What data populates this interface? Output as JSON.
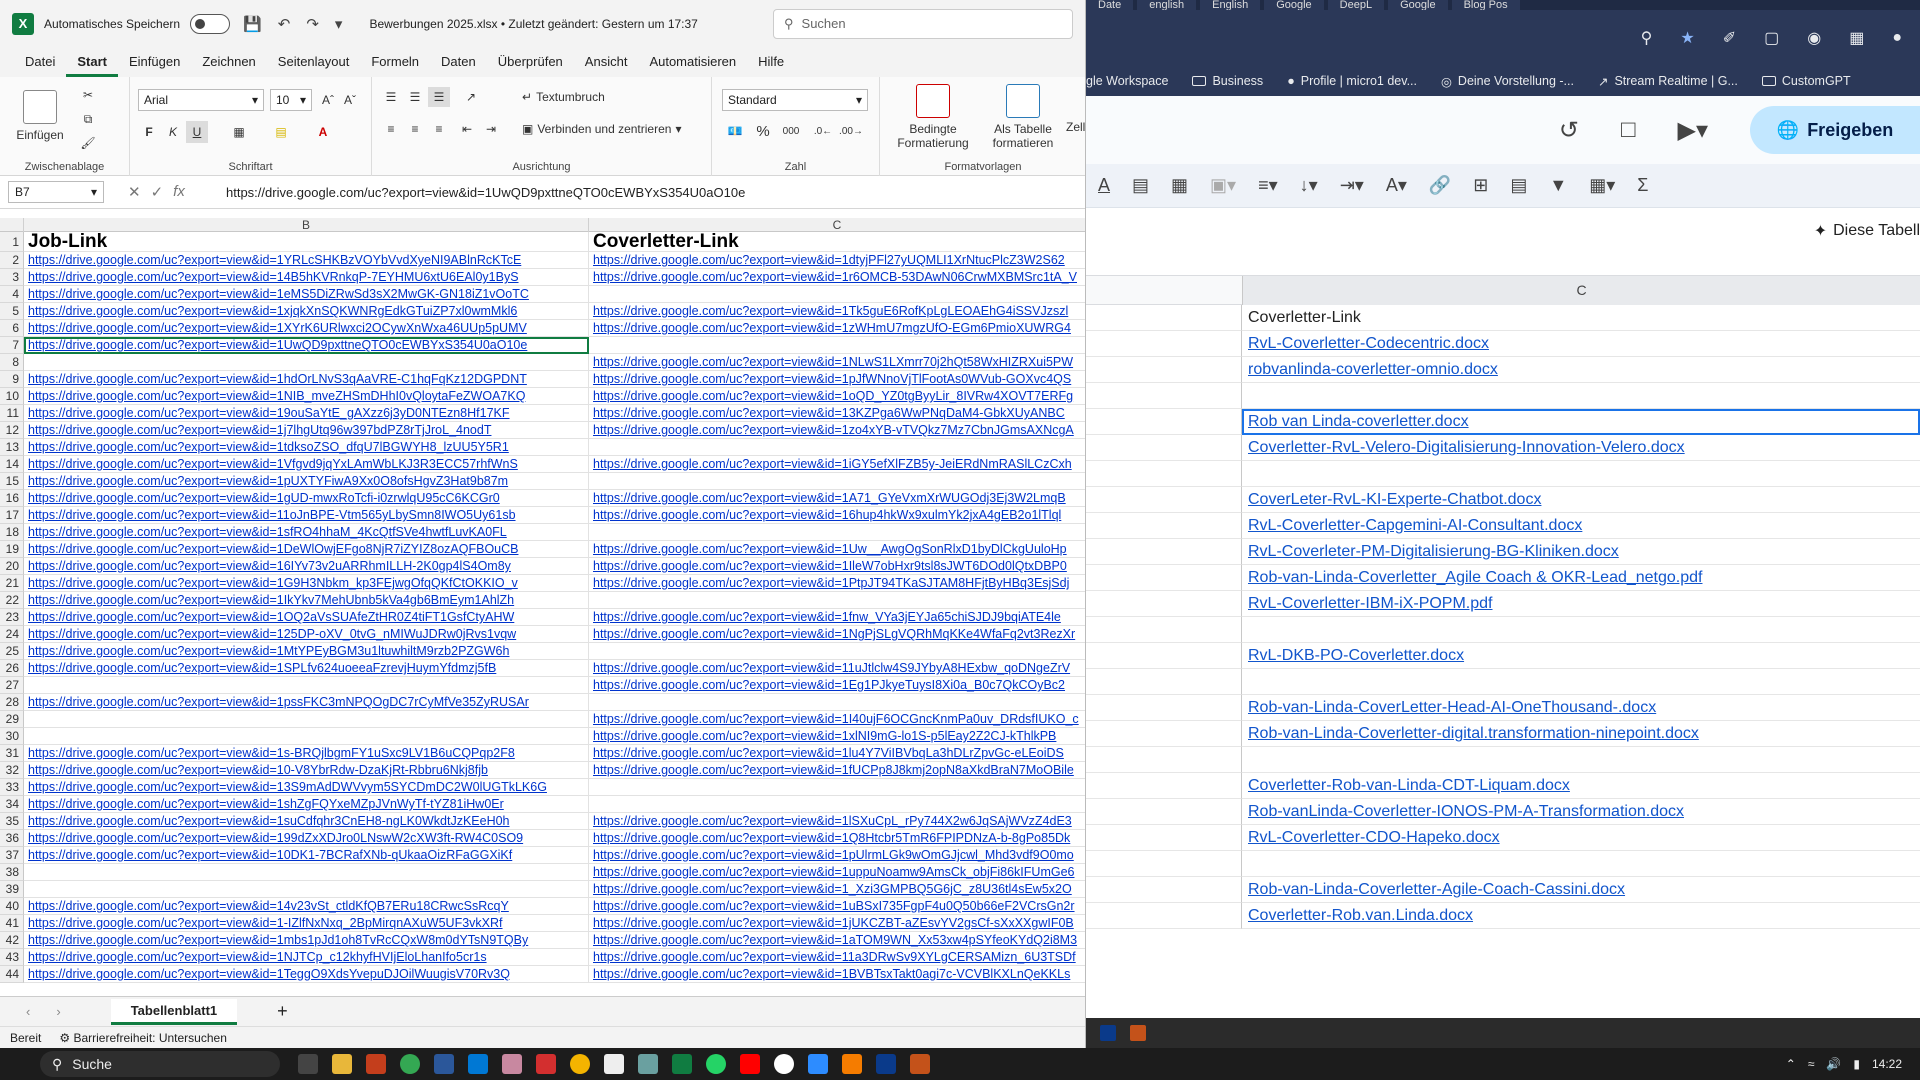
{
  "excel": {
    "title_bar": {
      "autosave_label": "Automatisches Speichern",
      "filename": "Bewerbungen 2025.xlsx • Zuletzt geändert: Gestern um 17:37",
      "search_placeholder": "Suchen"
    },
    "menu": [
      "Datei",
      "Start",
      "Einfügen",
      "Zeichnen",
      "Seitenlayout",
      "Formeln",
      "Daten",
      "Überprüfen",
      "Ansicht",
      "Automatisieren",
      "Hilfe"
    ],
    "ribbon": {
      "paste_label": "Einfügen",
      "clipboard_group": "Zwischenablage",
      "font_name": "Arial",
      "font_size": "10",
      "font_group": "Schriftart",
      "wrap_text": "Textumbruch",
      "merge_center": "Verbinden und zentrieren",
      "align_group": "Ausrichtung",
      "number_format": "Standard",
      "number_group": "Zahl",
      "cond_format": "Bedingte Formatierung",
      "table_format": "Als Tabelle formatieren",
      "cell_styles": "Zeller",
      "styles_group": "Formatvorlagen",
      "bold": "F",
      "italic": "K",
      "underline": "U"
    },
    "namebox": "B7",
    "formula": "https://drive.google.com/uc?export=view&id=1UwQD9pxttneQTO0cEWBYxS354U0aO10e",
    "columns": [
      "B",
      "C"
    ],
    "header_row": {
      "b": "Job-Link",
      "c": "Coverletter-Link"
    },
    "rows": [
      {
        "n": "2",
        "b": "https://drive.google.com/uc?export=view&id=1YRLcSHKBzVOYbVvdXyeNI9ABlnRcKTcE",
        "c": "https://drive.google.com/uc?export=view&id=1dtyjPFl27yUQMLI1XrNtucPlcZ3W2S62"
      },
      {
        "n": "3",
        "b": "https://drive.google.com/uc?export=view&id=14B5hKVRnkqP-7EYHMU6xtU6EAl0y1ByS",
        "c": "https://drive.google.com/uc?export=view&id=1r6OMCB-53DAwN06CrwMXBMSrc1tA_V"
      },
      {
        "n": "4",
        "b": "https://drive.google.com/uc?export=view&id=1eMS5DiZRwSd3sX2MwGK-GN18iZ1vOoTC",
        "c": ""
      },
      {
        "n": "5",
        "b": "https://drive.google.com/uc?export=view&id=1xjqkXnSQKWNRgEdkGTuiZP7xl0wmMkl6",
        "c": "https://drive.google.com/uc?export=view&id=1Tk5guE6RofKpLgLEOAEhG4iSSVJzszl"
      },
      {
        "n": "6",
        "b": "https://drive.google.com/uc?export=view&id=1XYrK6URlwxci2OCywXnWxa46UUp5pUMV",
        "c": "https://drive.google.com/uc?export=view&id=1zWHmU7mgzUfO-EGm6PmioXUWRG4"
      },
      {
        "n": "7",
        "b": "https://drive.google.com/uc?export=view&id=1UwQD9pxttneQTO0cEWBYxS354U0aO10e",
        "c": ""
      },
      {
        "n": "8",
        "b": "",
        "c": "https://drive.google.com/uc?export=view&id=1NLwS1LXmrr70j2hQt58WxHIZRXui5PW"
      },
      {
        "n": "9",
        "b": "https://drive.google.com/uc?export=view&id=1hdOrLNvS3qAaVRE-C1hqFqKz12DGPDNT",
        "c": "https://drive.google.com/uc?export=view&id=1pJfWNnoVjTlFootAs0WVub-GOXvc4QS"
      },
      {
        "n": "10",
        "b": "https://drive.google.com/uc?export=view&id=1NIB_mveZHSmDHhI0vQloytaFeZWOA7KQ",
        "c": "https://drive.google.com/uc?export=view&id=1oQD_YZ0tgByyLir_8IVRw4XOVT7ERFg"
      },
      {
        "n": "11",
        "b": "https://drive.google.com/uc?export=view&id=19ouSaYtE_gAXzz6j3yD0NTEzn8Hf17KF",
        "c": "https://drive.google.com/uc?export=view&id=13KZPga6WwPNqDaM4-GbkXUyANBC"
      },
      {
        "n": "12",
        "b": "https://drive.google.com/uc?export=view&id=1j7lhgUtq96w397bdPZ8rTjJroL_4nodT",
        "c": "https://drive.google.com/uc?export=view&id=1zo4xYB-vTVQkz7Mz7CbnJGmsAXNcgA"
      },
      {
        "n": "13",
        "b": "https://drive.google.com/uc?export=view&id=1tdksoZSO_dfqU7lBGWYH8_lzUU5Y5R1",
        "c": ""
      },
      {
        "n": "14",
        "b": "https://drive.google.com/uc?export=view&id=1Vfgvd9jqYxLAmWbLKJ3R3ECC57rhfWnS",
        "c": "https://drive.google.com/uc?export=view&id=1iGY5efXlFZB5y-JeiERdNmRASlLCzCxh"
      },
      {
        "n": "15",
        "b": "https://drive.google.com/uc?export=view&id=1pUXTYFiwA9Xx0O8ofsHgvZ3Hat9b87m",
        "c": ""
      },
      {
        "n": "16",
        "b": "https://drive.google.com/uc?export=view&id=1gUD-mwxRoTcfi-i0zrwlqU95cC6KCGr0",
        "c": "https://drive.google.com/uc?export=view&id=1A71_GYeVxmXrWUGOdj3Ej3W2LmqB"
      },
      {
        "n": "17",
        "b": "https://drive.google.com/uc?export=view&id=11oJnBPE-Vtm565yLbySmn8IWO5Uy61sb",
        "c": "https://drive.google.com/uc?export=view&id=16hup4hkWx9xulmYk2jxA4gEB2o1lTlql"
      },
      {
        "n": "18",
        "b": "https://drive.google.com/uc?export=view&id=1sfRO4hhaM_4KcQtfSVe4hwtfLuvKA0FL",
        "c": ""
      },
      {
        "n": "19",
        "b": "https://drive.google.com/uc?export=view&id=1DeWlOwjEFgo8NjR7iZYIZ8ozAQFBOuCB",
        "c": "https://drive.google.com/uc?export=view&id=1Uw__AwgOgSonRlxD1byDlCkgUuloHp"
      },
      {
        "n": "20",
        "b": "https://drive.google.com/uc?export=view&id=16IYv73v2uARRhmILLH-2K0gp4lS4Om8y",
        "c": "https://drive.google.com/uc?export=view&id=1IleW7obHxr9tsl8sJWT6DOd0lQtxDBP0"
      },
      {
        "n": "21",
        "b": "https://drive.google.com/uc?export=view&id=1G9H3Nbkm_kp3FEjwgOfqQKfCtOKKIO_v",
        "c": "https://drive.google.com/uc?export=view&id=1PtpJT94TKaSJTAM8HFjtByHBq3EsjSdj"
      },
      {
        "n": "22",
        "b": "https://drive.google.com/uc?export=view&id=1IkYkv7MehUbnb5kVa4gb6BmEym1AhlZh",
        "c": ""
      },
      {
        "n": "23",
        "b": "https://drive.google.com/uc?export=view&id=1OQ2aVsSUAfeZtHR0Z4tiFT1GsfCtyAHW",
        "c": "https://drive.google.com/uc?export=view&id=1fnw_VYa3jEYJa65chiSJDJ9bqiATE4le"
      },
      {
        "n": "24",
        "b": "https://drive.google.com/uc?export=view&id=125DP-oXV_0tvG_nMIWuJDRw0jRvs1vqw",
        "c": "https://drive.google.com/uc?export=view&id=1NgPjSLgVQRhMqKKe4WfaFq2vt3RezXr"
      },
      {
        "n": "25",
        "b": "https://drive.google.com/uc?export=view&id=1MtYPEyBGM3u1ltuwhiltM9rzb2PZGW6h",
        "c": ""
      },
      {
        "n": "26",
        "b": "https://drive.google.com/uc?export=view&id=1SPLfv624uoeeaFzrevjHuymYfdmzj5fB",
        "c": "https://drive.google.com/uc?export=view&id=11uJtlclw4S9JYbyA8HExbw_qoDNgeZrV"
      },
      {
        "n": "27",
        "b": "",
        "c": "https://drive.google.com/uc?export=view&id=1Eg1PJkyeTuysI8Xi0a_B0c7QkCOyBc2"
      },
      {
        "n": "28",
        "b": "https://drive.google.com/uc?export=view&id=1pssFKC3mNPQOgDC7rCyMfVe35ZyRUSAr",
        "c": ""
      },
      {
        "n": "29",
        "b": "",
        "c": "https://drive.google.com/uc?export=view&id=1I40ujF6OCGncKnmPa0uv_DRdsfIUKO_c"
      },
      {
        "n": "30",
        "b": "",
        "c": "https://drive.google.com/uc?export=view&id=1xlNI9mG-lo1S-p5lEay2Z2CJ-kThlkPB"
      },
      {
        "n": "31",
        "b": "https://drive.google.com/uc?export=view&id=1s-BRQjlbgmFY1uSxc9LV1B6uCQPqp2F8",
        "c": "https://drive.google.com/uc?export=view&id=1lu4Y7ViIBVbqLa3hDLrZpvGc-eLEoiDS"
      },
      {
        "n": "32",
        "b": "https://drive.google.com/uc?export=view&id=10-V8YbrRdw-DzaKjRt-Rbbru6Nkj8fjb",
        "c": "https://drive.google.com/uc?export=view&id=1fUCPp8J8kmj2opN8aXkdBraN7MoOBile"
      },
      {
        "n": "33",
        "b": "https://drive.google.com/uc?export=view&id=13S9mAdDWVvym5SYCDmDC2W0lUGTkLK6G",
        "c": ""
      },
      {
        "n": "34",
        "b": "https://drive.google.com/uc?export=view&id=1shZgFQYxeMZpJVnWyTf-tYZ81iHw0Er",
        "c": ""
      },
      {
        "n": "35",
        "b": "https://drive.google.com/uc?export=view&id=1suCdfqhr3CnEH8-ngLK0WkdtJzKEeH0h",
        "c": "https://drive.google.com/uc?export=view&id=1lSXuCpL_rPy744X2w6JqSAjWVzZ4dE3"
      },
      {
        "n": "36",
        "b": "https://drive.google.com/uc?export=view&id=199dZxXDJro0LNswW2cXW3ft-RW4C0SO9",
        "c": "https://drive.google.com/uc?export=view&id=1Q8Htcbr5TmR6FPIPDNzA-b-8gPo85Dk"
      },
      {
        "n": "37",
        "b": "https://drive.google.com/uc?export=view&id=10DK1-7BCRafXNb-qUkaaOizRFaGGXiKf",
        "c": "https://drive.google.com/uc?export=view&id=1pUlrmLGk9wOmGJjcwl_Mhd3vdf9O0mo"
      },
      {
        "n": "38",
        "b": "",
        "c": "https://drive.google.com/uc?export=view&id=1uppuNoamw9AmsCk_objFi86kIFUmGe6"
      },
      {
        "n": "39",
        "b": "",
        "c": "https://drive.google.com/uc?export=view&id=1_Xzi3GMPBQ5G6jC_z8U36tl4sEw5x2O"
      },
      {
        "n": "40",
        "b": "https://drive.google.com/uc?export=view&id=14v23vSt_ctldKfQB7ERu18CRwcSsRcqY",
        "c": "https://drive.google.com/uc?export=view&id=1uBSxI735FgpF4u0Q50b66eF2VCrsGn2r"
      },
      {
        "n": "41",
        "b": "https://drive.google.com/uc?export=view&id=1-IZlfNxNxq_2BpMirqnAXuW5UF3vkXRf",
        "c": "https://drive.google.com/uc?export=view&id=1jUKCZBT-aZEsvYV2gsCf-sXxXXgwIF0B"
      },
      {
        "n": "42",
        "b": "https://drive.google.com/uc?export=view&id=1mbs1pJd1oh8TvRcCQxW8m0dYTsN9TQBy",
        "c": "https://drive.google.com/uc?export=view&id=1aTOM9WN_Xx53xw4pSYfeoKYdQ2i8M3"
      },
      {
        "n": "43",
        "b": "https://drive.google.com/uc?export=view&id=1NJTCp_c12khyfHVIjEloLhanIfo5cr1s",
        "c": "https://drive.google.com/uc?export=view&id=11a3DRwSv9XYLgCERSAMizn_6U3TSDf"
      },
      {
        "n": "44",
        "b": "https://drive.google.com/uc?export=view&id=1TeggO9XdsYvepuDJOilWuugisV70Rv3Q",
        "c": "https://drive.google.com/uc?export=view&id=1BVBTsxTakt0agi7c-VCVBlKXLnQeKKLs"
      }
    ],
    "sheet_tab": "Tabellenblatt1",
    "status_ready": "Bereit",
    "status_accessibility": "Barrierefreiheit: Untersuchen"
  },
  "chrome": {
    "tabs": [
      "Date",
      "english",
      "English",
      "Google",
      "DeepL",
      "Google",
      "Blog Pos"
    ],
    "bookmarks": [
      "gle Workspace",
      "Business",
      "Profile | micro1 dev...",
      "Deine Vorstellung -...",
      "Stream Realtime | G...",
      "CustomGPT"
    ],
    "share_label": "Freigeben",
    "ai_bar_label": "Diese Tabell",
    "column_label": "C",
    "cells": [
      {
        "text": "Coverletter-Link",
        "link": false
      },
      {
        "text": "RvL-Coverletter-Codecentric.docx",
        "link": true
      },
      {
        "text": "robvanlinda-coverletter-omnio.docx",
        "link": true
      },
      {
        "text": "",
        "link": false
      },
      {
        "text": "Rob van Linda-coverletter.docx",
        "link": true,
        "selected": true
      },
      {
        "text": "Coverletter-RvL-Velero-Digitalisierung-Innovation-Velero.docx",
        "link": true
      },
      {
        "text": "",
        "link": false
      },
      {
        "text": "CoverLeter-RvL-KI-Experte-Chatbot.docx",
        "link": true
      },
      {
        "text": "RvL-Coverletter-Capgemini-AI-Consultant.docx",
        "link": true
      },
      {
        "text": "RvL-Coverleter-PM-Digitalisierung-BG-Kliniken.docx",
        "link": true
      },
      {
        "text": "Rob-van-Linda-Coverletter_Agile Coach & OKR-Lead_netgo.pdf",
        "link": true
      },
      {
        "text": "RvL-Coverletter-IBM-iX-POPM.pdf",
        "link": true
      },
      {
        "text": "",
        "link": false
      },
      {
        "text": "RvL-DKB-PO-Coverletter.docx",
        "link": true
      },
      {
        "text": "",
        "link": false
      },
      {
        "text": "Rob-van-Linda-CoverLetter-Head-AI-OneThousand-.docx",
        "link": true
      },
      {
        "text": "Rob-van-Linda-Coverletter-digital.transformation-ninepoint.docx",
        "link": true
      },
      {
        "text": "",
        "link": false
      },
      {
        "text": "Coverletter-Rob-van-Linda-CDT-Liquam.docx",
        "link": true
      },
      {
        "text": "Rob-vanLinda-Coverletter-IONOS-PM-A-Transformation.docx",
        "link": true
      },
      {
        "text": "RvL-Coverletter-CDO-Hapeko.docx",
        "link": true
      },
      {
        "text": "",
        "link": false
      },
      {
        "text": "Rob-van-Linda-Coverletter-Agile-Coach-Cassini.docx",
        "link": true
      },
      {
        "text": "Coverletter-Rob.van.Linda.docx",
        "link": true
      }
    ]
  },
  "taskbar": {
    "search_label": "Suche",
    "time": "14:22"
  }
}
